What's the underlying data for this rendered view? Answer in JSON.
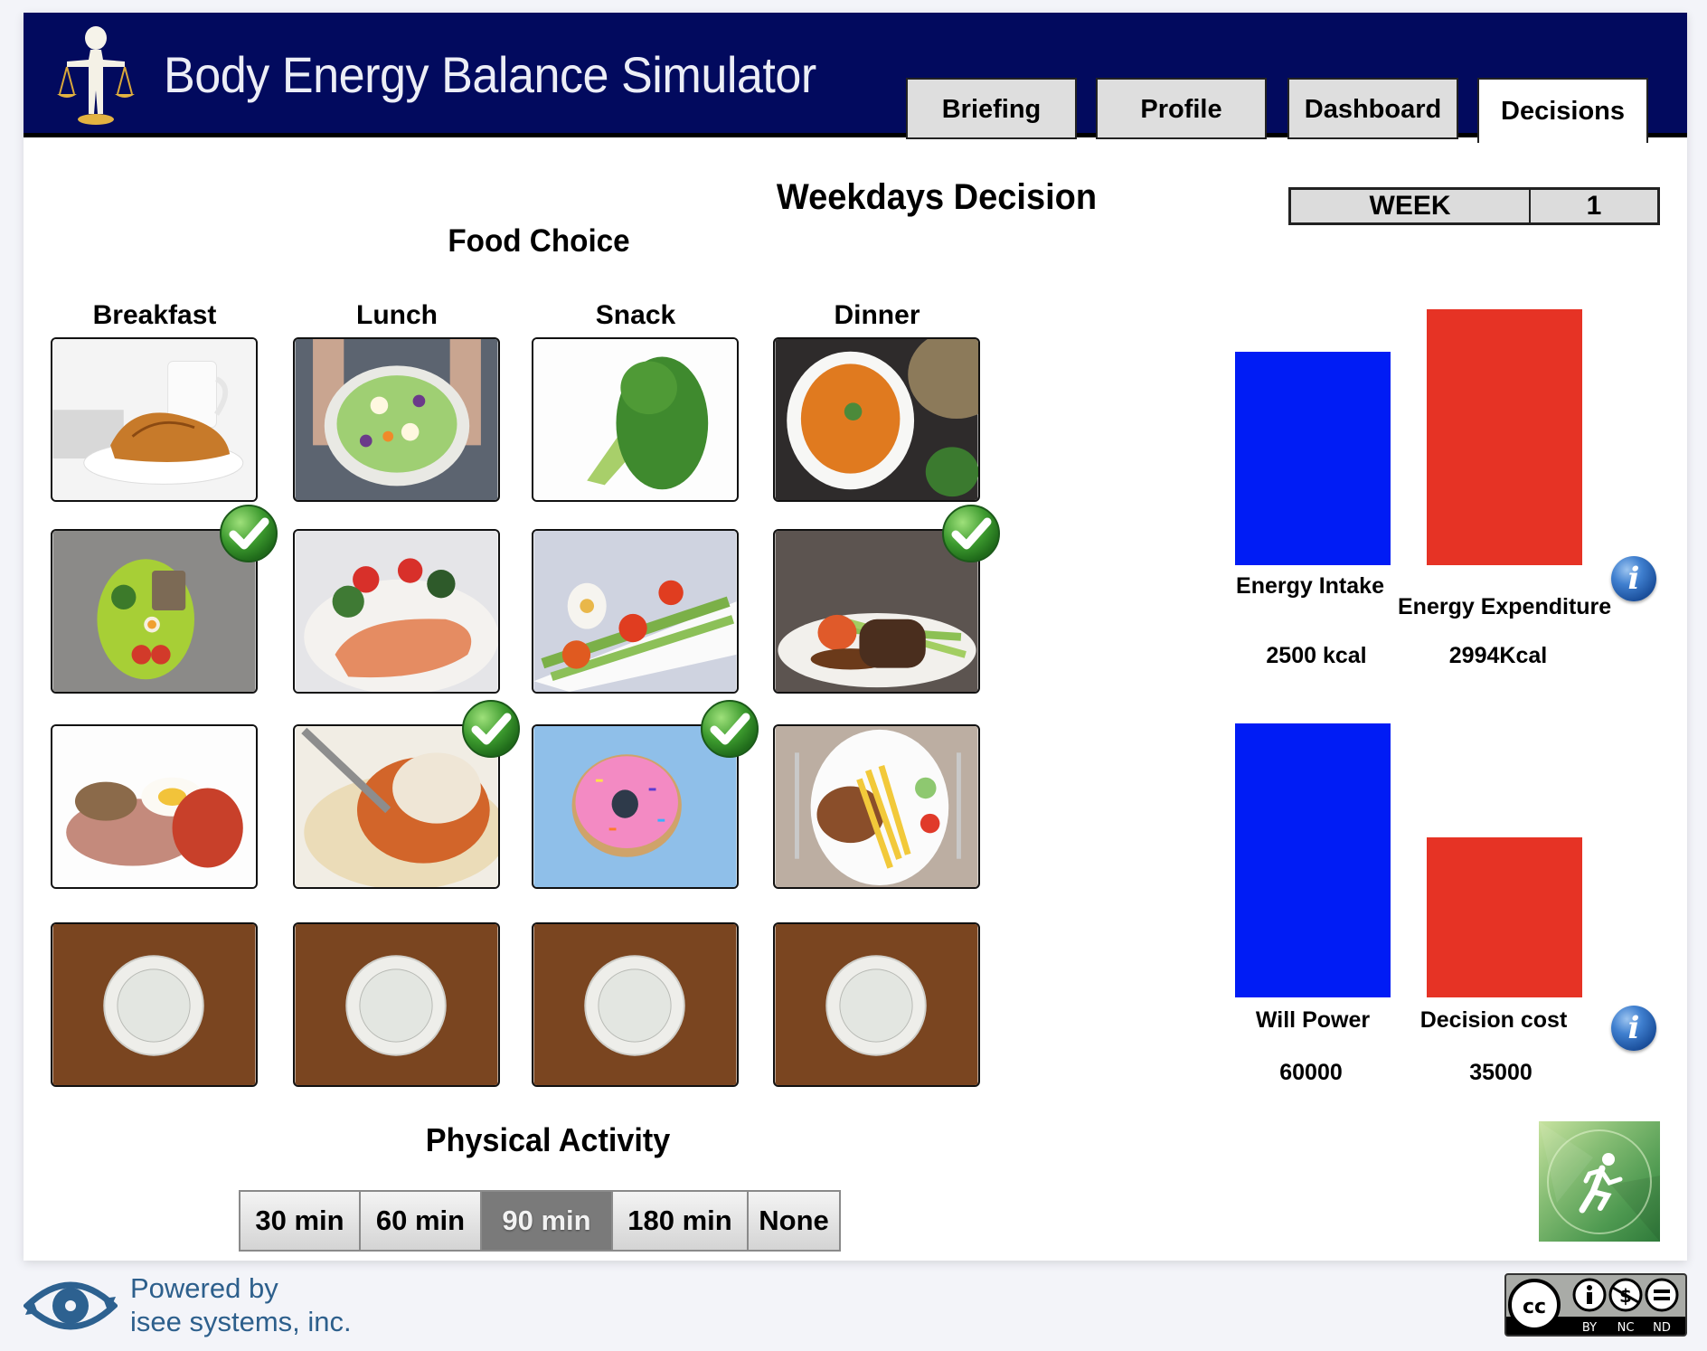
{
  "app": {
    "title": "Body Energy Balance Simulator",
    "tabs": [
      {
        "label": "Briefing",
        "active": false
      },
      {
        "label": "Profile",
        "active": false
      },
      {
        "label": "Dashboard",
        "active": false
      },
      {
        "label": "Decisions",
        "active": true
      }
    ]
  },
  "main": {
    "title": "Weekdays Decision",
    "week": {
      "label": "WEEK",
      "value": "1"
    },
    "food_choice": {
      "title": "Food Choice",
      "columns": [
        "Breakfast",
        "Lunch",
        "Snack",
        "Dinner"
      ],
      "grid": [
        [
          {
            "item": "Croissant with coffee",
            "selected": false
          },
          {
            "item": "Green salad bowl",
            "selected": false
          },
          {
            "item": "Broccoli",
            "selected": false
          },
          {
            "item": "Tomato soup",
            "selected": false
          }
        ],
        [
          {
            "item": "Bread, egg and vegetable plate",
            "selected": true
          },
          {
            "item": "Grilled salmon with salad",
            "selected": false
          },
          {
            "item": "Egg, asparagus and tomato salad",
            "selected": false
          },
          {
            "item": "Steak with asparagus",
            "selected": true
          }
        ],
        [
          {
            "item": "Bacon, egg and grilled tomato",
            "selected": false
          },
          {
            "item": "Spaghetti bolognese",
            "selected": true
          },
          {
            "item": "Pink sprinkled donut",
            "selected": true
          },
          {
            "item": "Pork chop with fries",
            "selected": false
          }
        ],
        [
          {
            "item": "Empty plate (skip)",
            "selected": false
          },
          {
            "item": "Empty plate (skip)",
            "selected": false
          },
          {
            "item": "Empty plate (skip)",
            "selected": false
          },
          {
            "item": "Empty plate (skip)",
            "selected": false
          }
        ]
      ]
    },
    "physical_activity": {
      "title": "Physical Activity",
      "options": [
        "30 min",
        "60 min",
        "90 min",
        "180 min",
        "None"
      ],
      "selected": "90 min"
    },
    "run_button_icon": "running-person-icon"
  },
  "chart_data": [
    {
      "type": "bar",
      "categories": [
        "Energy Intake",
        "Energy Expenditure"
      ],
      "values": [
        2500,
        2994
      ],
      "value_labels": [
        "2500 kcal",
        "2994Kcal"
      ],
      "colors": [
        "#001cf5",
        "#e63325"
      ],
      "ylim": [
        0,
        3600
      ],
      "grid": false,
      "title": "",
      "xlabel": "",
      "ylabel": ""
    },
    {
      "type": "bar",
      "categories": [
        "Will Power",
        "Decision cost"
      ],
      "values": [
        60000,
        35000
      ],
      "value_labels": [
        "60000",
        "35000"
      ],
      "colors": [
        "#001cf5",
        "#e63325"
      ],
      "ylim": [
        0,
        60000
      ],
      "grid": false,
      "title": "",
      "xlabel": "",
      "ylabel": ""
    }
  ],
  "footer": {
    "powered_line1": "Powered by",
    "powered_line2": "isee systems, inc.",
    "license": {
      "by": "BY",
      "nc": "NC",
      "nd": "ND",
      "cc": "cc"
    }
  }
}
